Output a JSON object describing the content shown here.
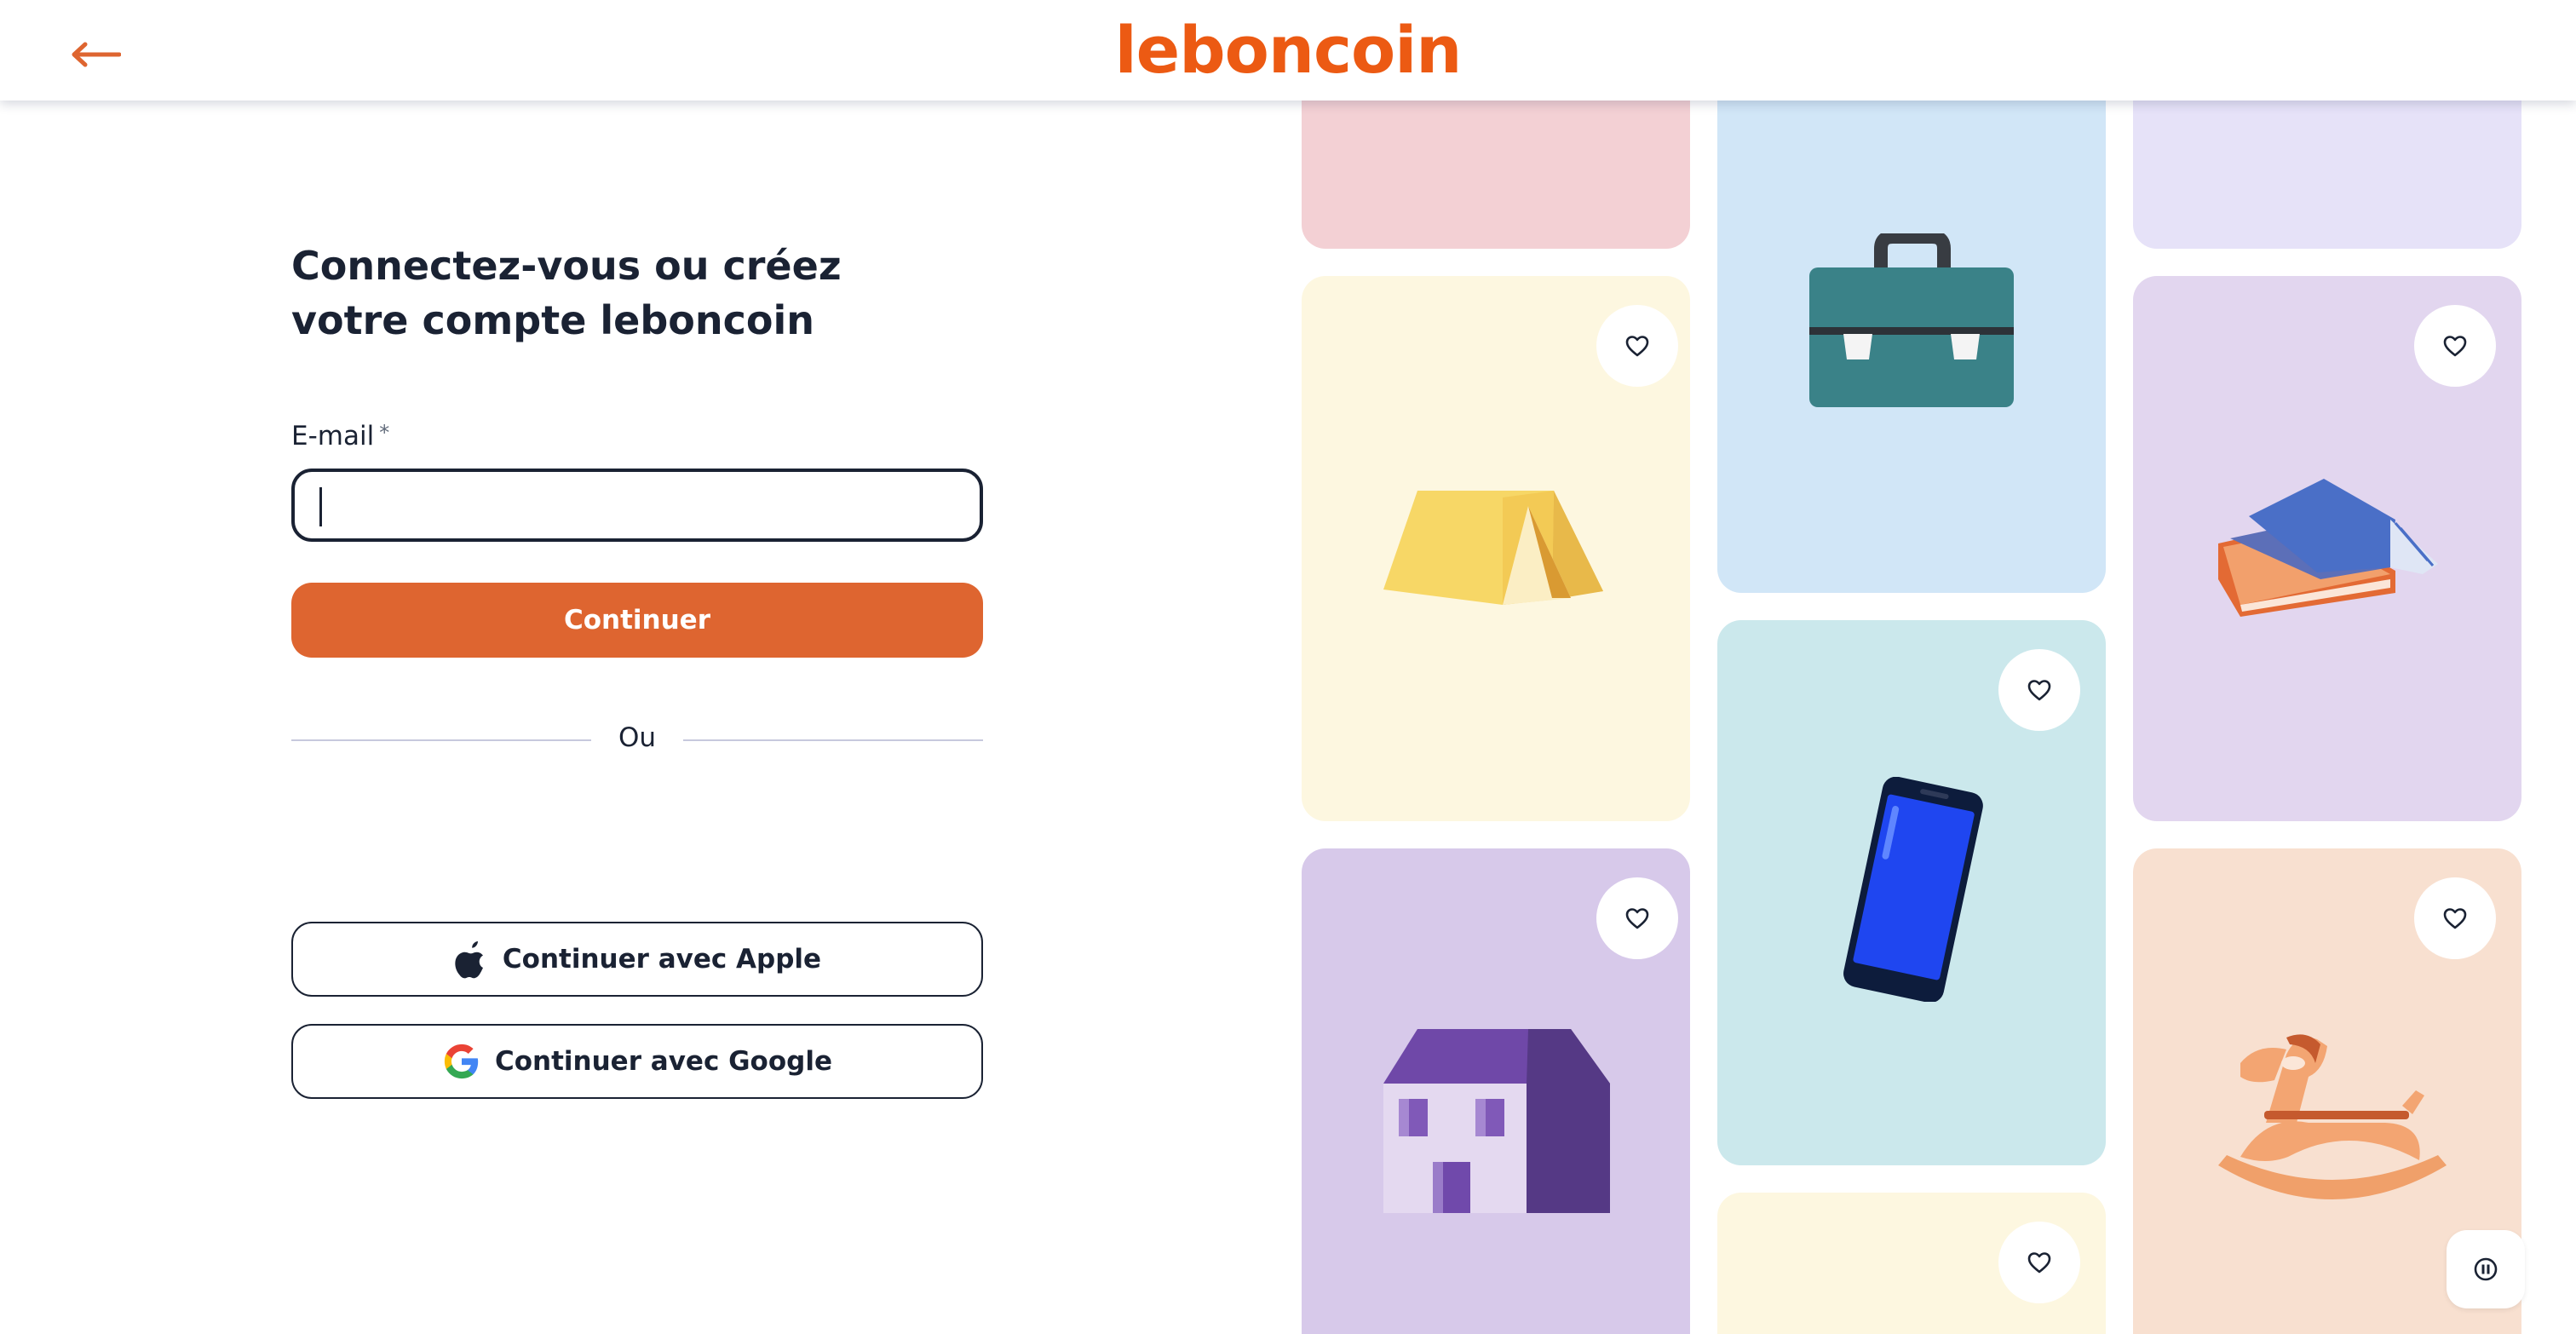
{
  "header": {
    "logo_text": "leboncoin",
    "back_icon": "arrow-left-icon",
    "brand_color": "#ec5a13"
  },
  "login": {
    "title": "Connectez-vous ou créez votre compte leboncoin",
    "email_label": "E-mail",
    "email_required_mark": "*",
    "email_value": "",
    "continue_label": "Continuer",
    "divider_text": "Ou",
    "apple_label": "Continuer avec Apple",
    "google_label": "Continuer avec Google",
    "continue_color": "#de6530"
  },
  "gallery": {
    "cards": [
      {
        "name": "pink-card",
        "color": "#f3d0d4"
      },
      {
        "name": "suitcase-card",
        "color": "#d1e6f7",
        "icon": "suitcase-icon"
      },
      {
        "name": "lavender-card",
        "color": "#e6e2f8"
      },
      {
        "name": "tent-card",
        "color": "#fdf7e0",
        "icon": "tent-icon"
      },
      {
        "name": "book-card",
        "color": "#e2d6ef",
        "icon": "book-icon"
      },
      {
        "name": "phone-card",
        "color": "#cbe8ec",
        "icon": "smartphone-icon"
      },
      {
        "name": "house-card",
        "color": "#d7c9ea",
        "icon": "house-icon"
      },
      {
        "name": "rocking-horse-card",
        "color": "#f8e0d0",
        "icon": "rocking-horse-icon"
      },
      {
        "name": "yellow-card",
        "color": "#fdf7e0"
      }
    ],
    "favorite_icon": "heart-outline-icon",
    "pause_icon": "pause-icon"
  }
}
